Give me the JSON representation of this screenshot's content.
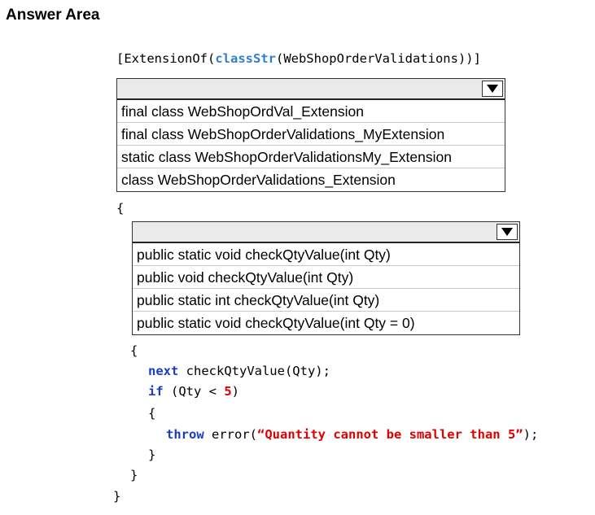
{
  "heading": "Answer Area",
  "code": {
    "attr_open": "[ExtensionOf(",
    "attr_kw": "classStr",
    "attr_rest": "(WebShopOrderValidations))]",
    "brace_open_outer": "{",
    "brace_open_method": "{",
    "next_kw": "next",
    "next_rest": " checkQtyValue(Qty);",
    "if_kw": "if",
    "if_rest_a": " (Qty < ",
    "if_num": "5",
    "if_rest_b": ")",
    "brace_open_if": "{",
    "throw_kw": "throw",
    "throw_mid": " error(",
    "throw_str": "“Quantity cannot be smaller than 5”",
    "throw_end": ");",
    "brace_close_if": "}",
    "brace_close_method": "}",
    "brace_close_outer": "}"
  },
  "dropdown1": {
    "selected": "",
    "options": [
      "final class WebShopOrdVal_Extension",
      "final class WebShopOrderValidations_MyExtension",
      "static class WebShopOrderValidationsMy_Extension",
      "class WebShopOrderValidations_Extension"
    ]
  },
  "dropdown2": {
    "selected": "",
    "options": [
      "public static void checkQtyValue(int Qty)",
      "public void checkQtyValue(int Qty)",
      "public static int checkQtyValue(int Qty)",
      "public static void checkQtyValue(int Qty = 0)"
    ]
  },
  "icons": {
    "dropdown_arrow": "triangle-down-icon"
  }
}
